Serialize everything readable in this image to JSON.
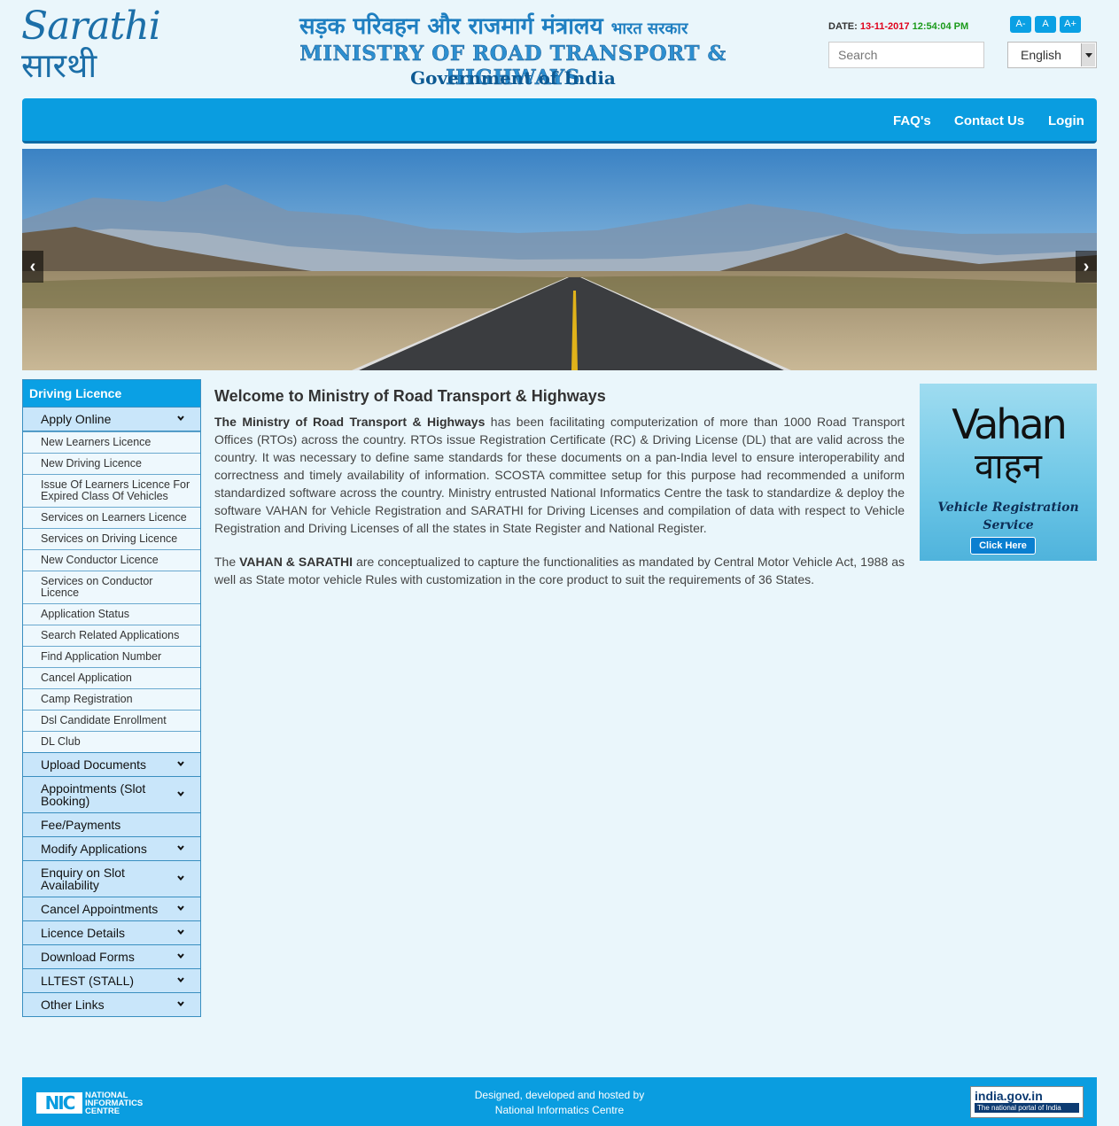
{
  "header": {
    "logo_en": "Sarathi",
    "logo_hi": "सारथी",
    "hindi_title": "सड़क परिवहन और राजमार्ग मंत्रालय",
    "hindi_sub": "भारत सरकार",
    "ministry": "MINISTRY OF ROAD TRANSPORT & HIGHWAYS",
    "government": "Government of India",
    "date_label": "DATE:",
    "date": "13-11-2017",
    "time": "12:54:04 PM",
    "font_buttons": [
      "A-",
      "A",
      "A+"
    ],
    "search_placeholder": "Search",
    "language": "English"
  },
  "nav": {
    "faqs": "FAQ's",
    "contact": "Contact Us",
    "login": "Login"
  },
  "sidebar": {
    "title": "Driving Licence",
    "apply_online": "Apply Online",
    "apply_items": [
      "New Learners Licence",
      "New Driving Licence",
      "Issue Of Learners Licence For Expired Class Of Vehicles",
      "Services on Learners Licence",
      "Services on Driving Licence",
      "New Conductor Licence",
      "Services on Conductor Licence",
      "Application Status",
      "Search Related Applications",
      "Find Application Number",
      "Cancel Application",
      "Camp Registration",
      "Dsl Candidate Enrollment",
      "DL Club"
    ],
    "sections": [
      "Upload Documents",
      "Appointments (Slot Booking)",
      "Fee/Payments",
      "Modify Applications",
      "Enquiry on Slot Availability",
      "Cancel Appointments",
      "Licence Details",
      "Download Forms",
      "LLTEST (STALL)",
      "Other Links"
    ]
  },
  "main": {
    "heading": "Welcome to Ministry of Road Transport & Highways",
    "p1_bold": "The Ministry of Road Transport & Highways",
    "p1_rest": " has been facilitating computerization of more than 1000 Road Transport Offices (RTOs) across the country. RTOs issue Registration Certificate (RC) & Driving License (DL) that are valid across the country. It was necessary to define same standards for these documents on a pan-India level to ensure interoperability and correctness and timely availability of information. SCOSTA committee setup for this purpose had recommended a uniform standardized software across the country. Ministry entrusted National Informatics Centre the task to standardize & deploy the software VAHAN for Vehicle Registration and SARATHI for Driving Licenses and compilation of data with respect to Vehicle Registration and Driving Licenses of all the states in State Register and National Register.",
    "p2_pre": "The ",
    "p2_bold": "VAHAN & SARATHI",
    "p2_rest": " are conceptualized to capture the functionalities as mandated by Central Motor Vehicle Act, 1988 as well as State motor vehicle Rules with customization in the core product to suit the requirements of 36 States."
  },
  "vahan": {
    "title_en": "Vahan",
    "title_hi": "वाहन",
    "service": "Vehicle Registration Service",
    "button": "Click Here"
  },
  "footer": {
    "line1": "Designed, developed and hosted by",
    "line2": "National Informatics Centre",
    "nic_logo": "NIC",
    "nic_text": "NATIONAL INFORMATICS CENTRE",
    "india_gov": "india.gov.in",
    "india_gov_sub": "The national portal of India"
  },
  "colors": {
    "primary": "#0a9de0",
    "sidebar_item": "#c9e6fa",
    "date": "#e0001b",
    "time": "#1a9a1a"
  }
}
